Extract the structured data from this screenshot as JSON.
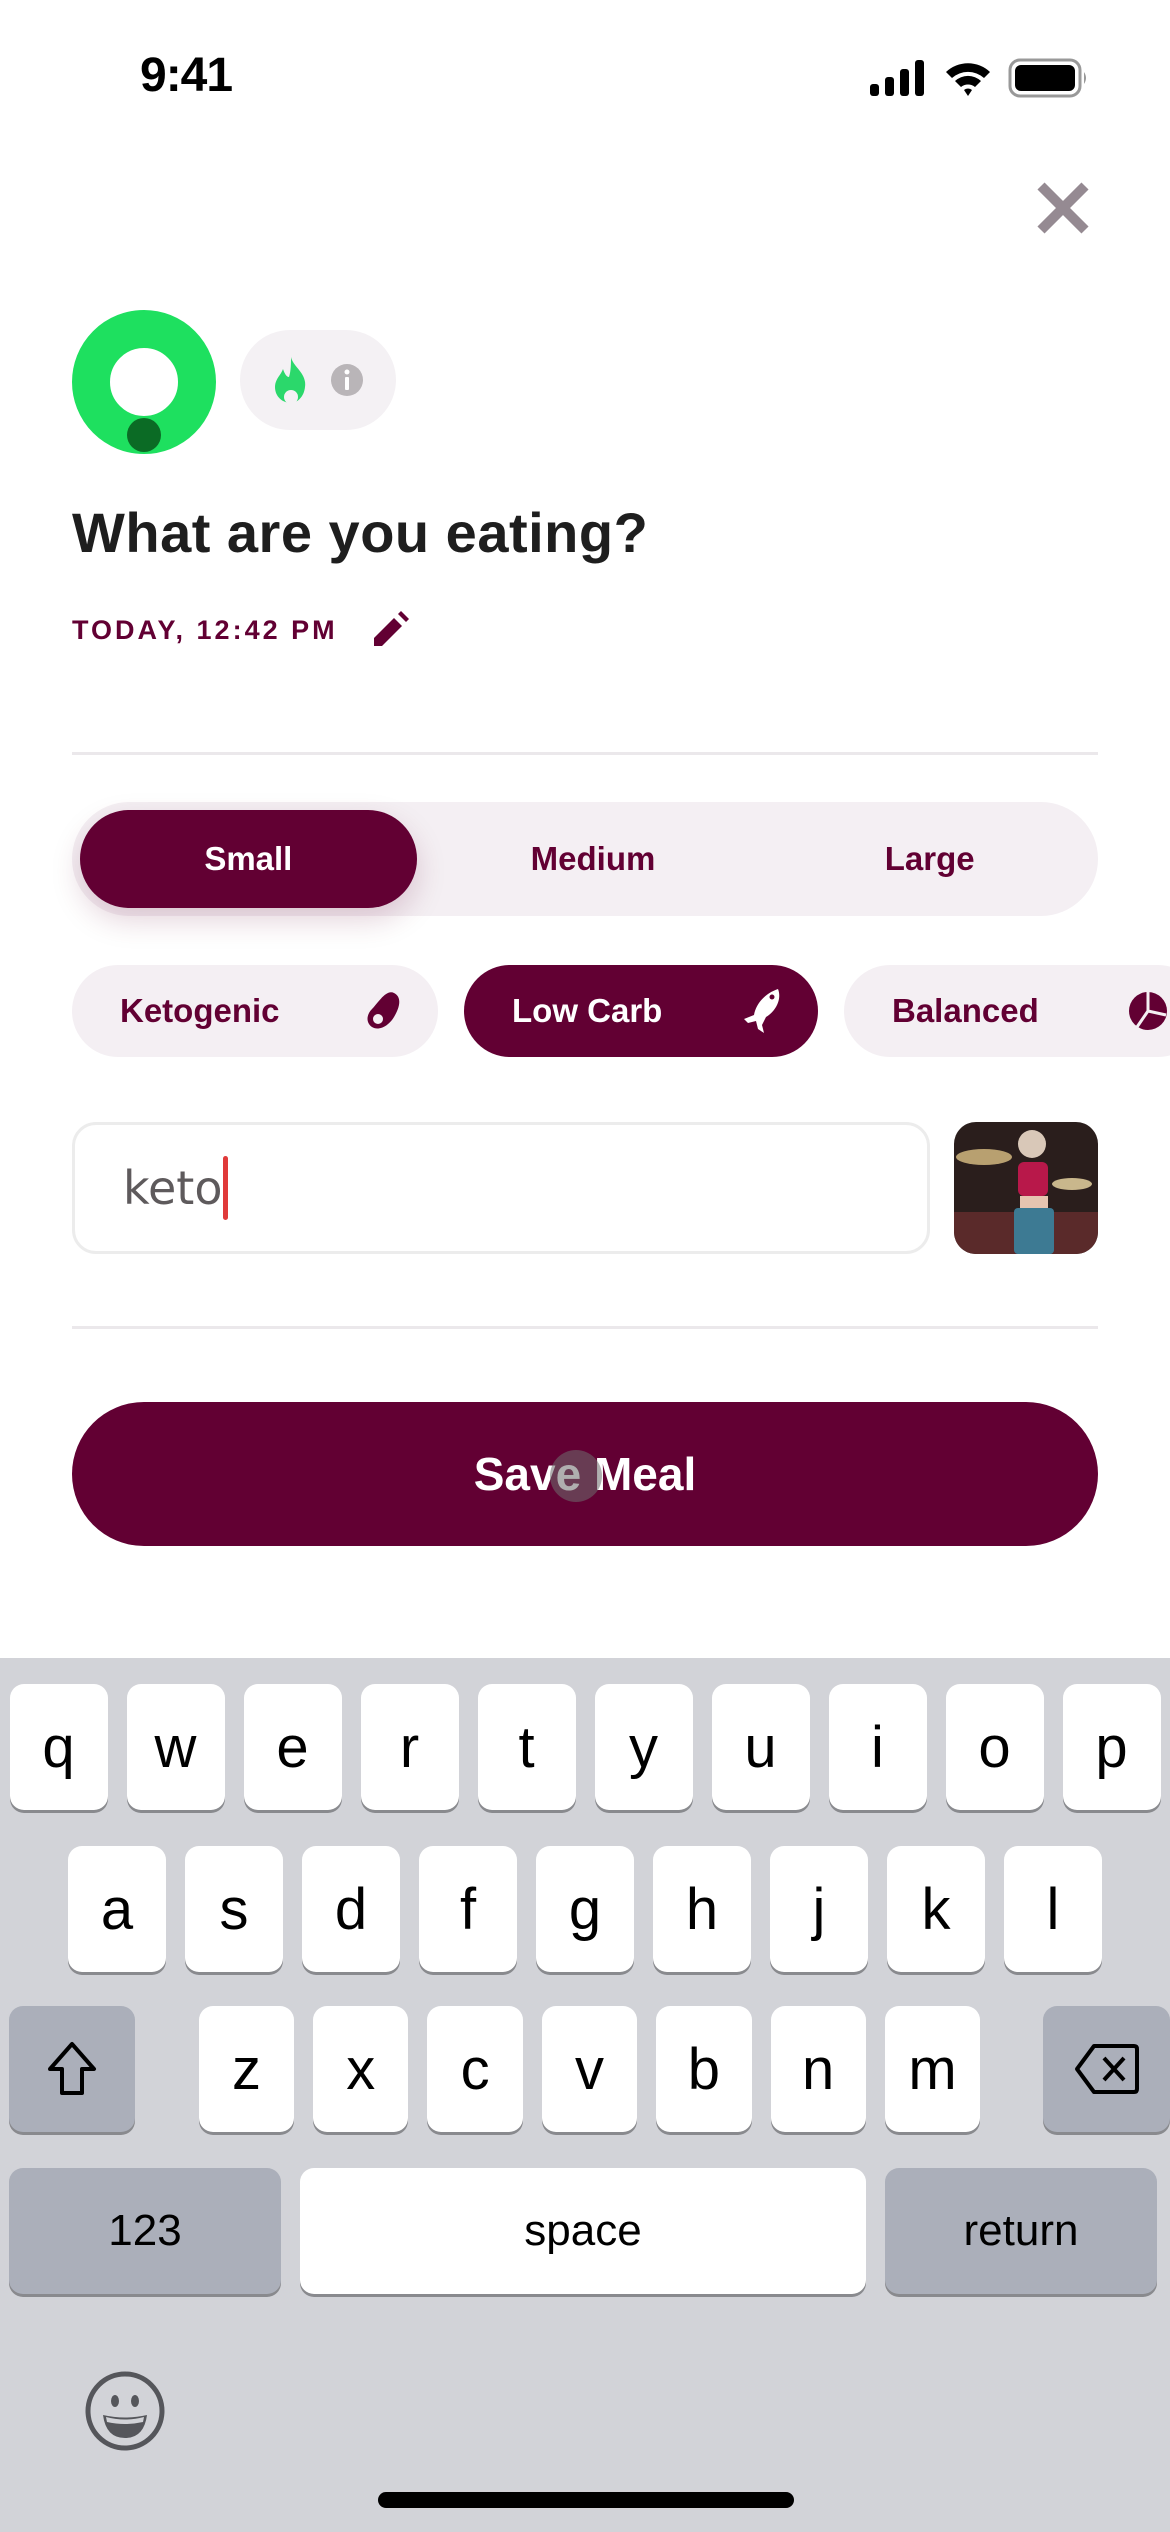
{
  "status_bar": {
    "time": "9:41",
    "signal_icon": "cellular-signal-icon",
    "wifi_icon": "wifi-icon",
    "battery_icon": "battery-icon"
  },
  "header": {
    "close_icon": "close-icon",
    "progress_ring_icon": "progress-ring-icon",
    "streak_icon": "flame-icon",
    "info_icon": "info-icon",
    "title": "What are you eating?",
    "date_time": "TODAY, 12:42 PM",
    "edit_icon": "pencil-icon"
  },
  "portion_sizes": {
    "options": [
      {
        "label": "Small",
        "selected": true
      },
      {
        "label": "Medium",
        "selected": false
      },
      {
        "label": "Large",
        "selected": false
      }
    ]
  },
  "diet_types": {
    "options": [
      {
        "label": "Ketogenic",
        "icon": "avocado-icon",
        "selected": false
      },
      {
        "label": "Low Carb",
        "icon": "fish-icon",
        "selected": true
      },
      {
        "label": "Balanced",
        "icon": "pie-chart-icon",
        "selected": false
      }
    ]
  },
  "meal_input": {
    "value": "keto",
    "photo_icon": "meal-photo-thumbnail"
  },
  "save_button": {
    "label": "Save Meal"
  },
  "colors": {
    "brand": "#620033",
    "chip_bg": "#f4eff3",
    "ring_green": "#1ee05f",
    "ring_dark": "#0b6b25",
    "caret": "#e03a3a"
  },
  "keyboard": {
    "row1": [
      "q",
      "w",
      "e",
      "r",
      "t",
      "y",
      "u",
      "i",
      "o",
      "p"
    ],
    "row2": [
      "a",
      "s",
      "d",
      "f",
      "g",
      "h",
      "j",
      "k",
      "l"
    ],
    "row3": [
      "z",
      "x",
      "c",
      "v",
      "b",
      "n",
      "m"
    ],
    "shift_icon": "shift-icon",
    "delete_icon": "backspace-icon",
    "numbers_label": "123",
    "space_label": "space",
    "return_label": "return",
    "emoji_icon": "emoji-icon"
  }
}
